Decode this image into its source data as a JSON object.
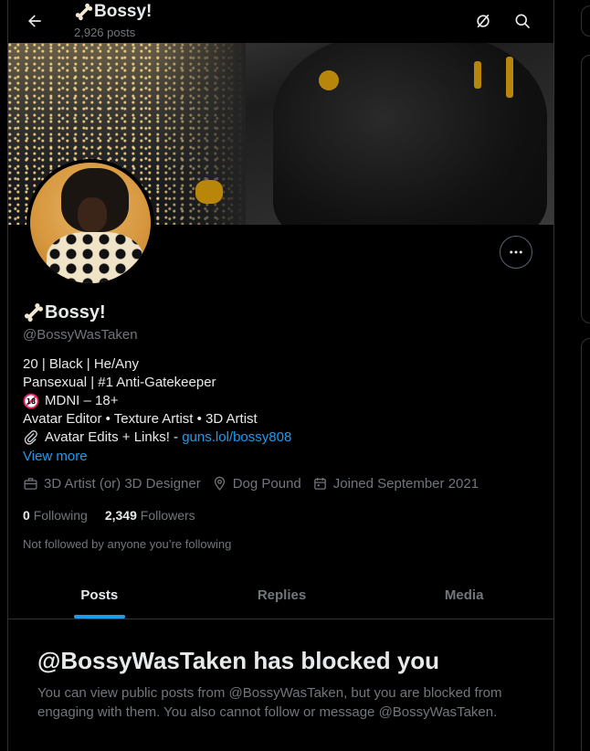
{
  "header": {
    "title": "Bossy!",
    "title_emoji": "bone-icon",
    "post_count": "2,926 posts"
  },
  "profile": {
    "name": "Bossy!",
    "handle": "@BossyWasTaken",
    "bio": {
      "line1": "20 | Black | He/Any",
      "line2": "Pansexual | #1 Anti-Gatekeeper",
      "line3_badge": "18",
      "line3": "MDNI – 18+",
      "line4": "Avatar Editor • Texture Artist • 3D Artist",
      "line5": "Avatar Edits + Links! - ",
      "line5_link": "guns.lol/bossy808"
    },
    "view_more": "View more",
    "meta": {
      "category": "3D Artist (or) 3D Designer",
      "location": "Dog Pound",
      "joined": "Joined September 2021"
    },
    "following_count": "0",
    "following_label": "Following",
    "followers_count": "2,349",
    "followers_label": "Followers",
    "not_followed": "Not followed by anyone you’re following"
  },
  "tabs": [
    {
      "label": "Posts",
      "active": true
    },
    {
      "label": "Replies",
      "active": false
    },
    {
      "label": "Media",
      "active": false
    }
  ],
  "blocked": {
    "title": "@BossyWasTaken has blocked you",
    "message": "You can view public posts from @BossyWasTaken, but you are blocked from engaging with them. You also cannot follow or message @BossyWasTaken."
  },
  "colors": {
    "accent": "#1d9bf0",
    "text": "#e7e9ea",
    "muted": "#71767b",
    "border": "#2f3336"
  }
}
